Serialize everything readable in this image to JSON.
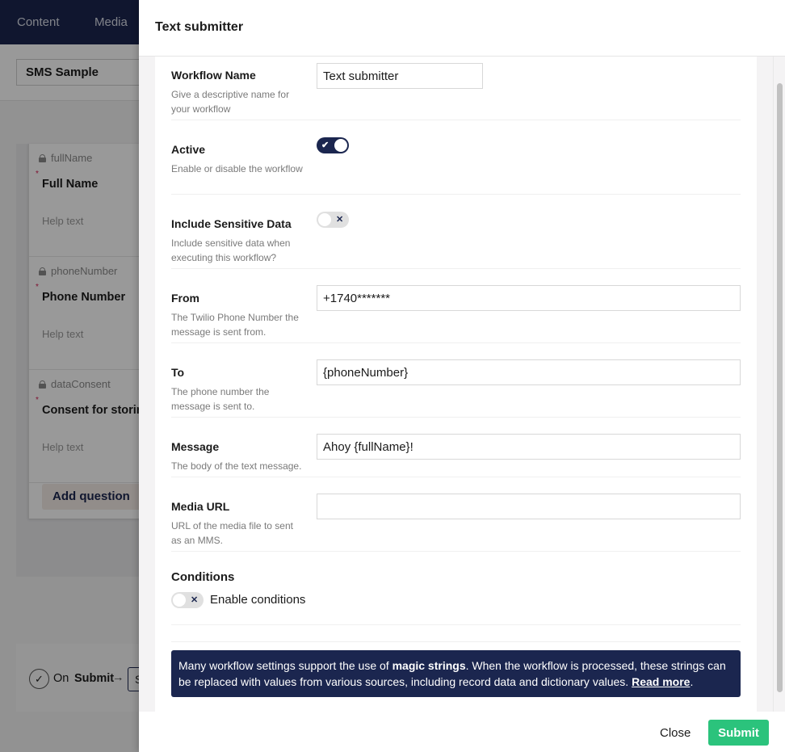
{
  "background_app": {
    "nav": [
      "Content",
      "Media"
    ],
    "form_name": "SMS Sample",
    "questions": [
      {
        "alias": "fullName",
        "label": "Full Name",
        "required": true,
        "help": "Help text"
      },
      {
        "alias": "phoneNumber",
        "label": "Phone Number",
        "required": true,
        "help": "Help text"
      },
      {
        "alias": "dataConsent",
        "label": "Consent for storing data",
        "required": true,
        "help": "Help text"
      }
    ],
    "add_question_label": "Add question",
    "workflow_trigger": {
      "on": "On",
      "event": "Submit",
      "arrow": "→",
      "next_box": "S"
    }
  },
  "modal": {
    "title": "Text submitter",
    "fields": {
      "workflow_name": {
        "label": "Workflow Name",
        "description": "Give a descriptive name for your workflow",
        "value": "Text submitter"
      },
      "active": {
        "label": "Active",
        "description": "Enable or disable the workflow",
        "checked": true,
        "glyph": "✔"
      },
      "sensitive": {
        "label": "Include Sensitive Data",
        "description": "Include sensitive data when executing this workflow?",
        "checked": false,
        "glyph": "✕"
      },
      "from": {
        "label": "From",
        "description": "The Twilio Phone Number the message is sent from.",
        "value": "+1740*******"
      },
      "to": {
        "label": "To",
        "description": "The phone number the message is sent to.",
        "value": "{phoneNumber}"
      },
      "message": {
        "label": "Message",
        "description": "The body of the text message.",
        "value": "Ahoy {fullName}!"
      },
      "media_url": {
        "label": "Media URL",
        "description": "URL of the media file to sent as an MMS.",
        "value": ""
      },
      "conditions": {
        "label": "Conditions",
        "toggle_label": "Enable conditions",
        "checked": false,
        "glyph": "✕"
      }
    },
    "info": {
      "text_before": "Many workflow settings support the use of ",
      "bold": "magic strings",
      "text_after": ". When the workflow is processed, these strings can be replaced with values from various sources, including record data and dictionary values. ",
      "link": "Read more",
      "end": "."
    },
    "footer": {
      "close_label": "Close",
      "submit_label": "Submit"
    }
  },
  "colors": {
    "brand": "#1b264f",
    "submit": "#2bc37c",
    "required": "#d42054"
  }
}
